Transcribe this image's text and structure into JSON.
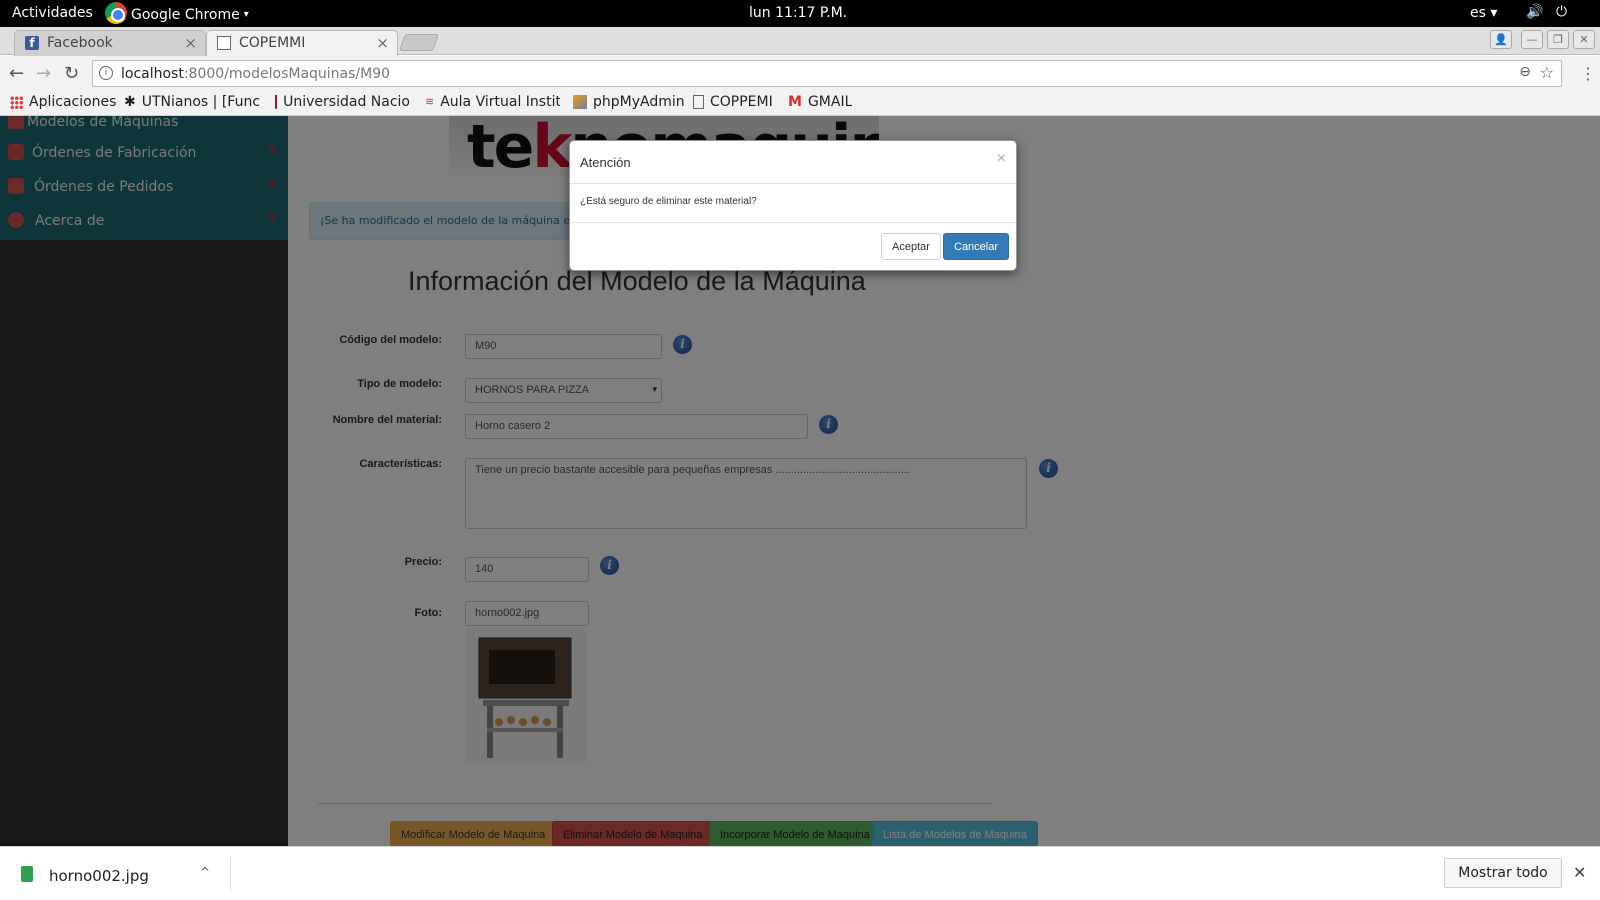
{
  "topbar": {
    "activities": "Actividades",
    "app_name": "Google Chrome",
    "app_caret": "▾",
    "clock": "lun 11:17 P.M.",
    "language": "es ▾",
    "volume_icon": "🔊",
    "power_icon": "⏻"
  },
  "tabs": [
    {
      "label": "Facebook",
      "icon": "facebook-icon",
      "close": "×"
    },
    {
      "label": "COPEMMI",
      "icon": "page-icon",
      "close": "×"
    }
  ],
  "window_controls": [
    "👤",
    "—",
    "❐",
    "✕"
  ],
  "address_bar": {
    "host": "localhost",
    "path": ":8000/modelosMaquinas/M90",
    "info_icon": "i",
    "zoom_icon": "⊖",
    "star_icon": "☆"
  },
  "nav": {
    "back": "←",
    "forward": "→",
    "reload": "↻",
    "menu": "⋮"
  },
  "bookmarks": [
    "Aplicaciones",
    "UTNianos | [Func",
    "Universidad Nacio",
    "Aula Virtual Instit",
    "phpMyAdmin",
    "COPPEMI",
    "GMAIL"
  ],
  "sidebar": {
    "items": [
      {
        "label": "Modelos de Máquinas"
      },
      {
        "label": "Órdenes de Fabricación",
        "caret": "▼"
      },
      {
        "label": "Órdenes de Pedidos",
        "caret": "▼"
      },
      {
        "label": "Acerca de",
        "caret": "▼"
      }
    ]
  },
  "logo": {
    "text_pre": "te",
    "text_k": "k",
    "text_post": "nomaquinas"
  },
  "alert": {
    "text": "¡Se ha modificado el modelo de la máquina exitósame"
  },
  "form": {
    "title": "Información del Modelo de la Máquina",
    "fields": {
      "codigo": {
        "label": "Código del modelo:",
        "value": "M90"
      },
      "tipo": {
        "label": "Tipo de modelo:",
        "value": "HORNOS PARA PIZZA"
      },
      "nombre": {
        "label": "Nombre del material:",
        "value": "Horno casero 2"
      },
      "caracteristicas": {
        "label": "Características:",
        "value": "Tiene un precio bastante accesible para pequeñas empresas ............................................"
      },
      "precio": {
        "label": "Precio:",
        "value": "140"
      },
      "foto": {
        "label": "Foto:",
        "value": "horno002.jpg"
      }
    },
    "help_icon": "i"
  },
  "actions": {
    "modificar": "Modificar Modelo de Maquina",
    "eliminar": "Eliminar Modelo de Maquina",
    "incorporar": "Incorporar Modelo de Maquina",
    "lista": "Lista de Modelos de Maquina"
  },
  "colors": {
    "modificar": "#f0ad4e",
    "eliminar": "#d9534f",
    "incorporar": "#5cb85c",
    "lista": "#5bc0de",
    "primary": "#337ab7"
  },
  "modal": {
    "title": "Atención",
    "close": "×",
    "body": "¿Está seguro de eliminar este material?",
    "accept": "Aceptar",
    "cancel": "Cancelar"
  },
  "downloads": {
    "filename": "horno002.jpg",
    "caret": "^",
    "show_all": "Mostrar todo",
    "close": "✕"
  }
}
